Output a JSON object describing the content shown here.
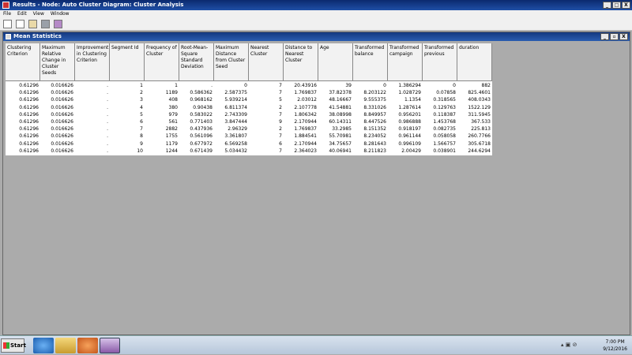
{
  "window": {
    "title": "Results - Node: Auto Cluster  Diagram: Cluster Analysis",
    "min": "_",
    "max": "□",
    "close": "X"
  },
  "menu": [
    "File",
    "Edit",
    "View",
    "Window"
  ],
  "subwindow": {
    "title": "Mean Statistics",
    "min": "_",
    "max": "▫",
    "close": "X"
  },
  "table": {
    "headers": [
      "Clustering Criterion",
      "Maximum Relative Change in Cluster Seeds",
      "Improvement in Clustering Criterion",
      "Segment Id",
      "Frequency of Cluster",
      "Root-Mean-Square Standard Deviation",
      "Maximum Distance from Cluster Seed",
      "Nearest Cluster",
      "Distance to Nearest Cluster",
      "Age",
      "Transformed balance",
      "Transformed campaign",
      "Transformed previous",
      "duration"
    ],
    "rows": [
      [
        "0.61296",
        "0.016626",
        ".",
        "1",
        "1",
        ".",
        "0",
        "7",
        "20.43916",
        "39",
        "0",
        "1.386294",
        "0",
        "882"
      ],
      [
        "0.61296",
        "0.016626",
        ".",
        "2",
        "1189",
        "0.586362",
        "2.587375",
        "7",
        "1.769837",
        "37.82378",
        "8.203122",
        "1.028729",
        "0.07858",
        "825.4601"
      ],
      [
        "0.61296",
        "0.016626",
        ".",
        "3",
        "408",
        "0.968162",
        "5.939214",
        "5",
        "2.03012",
        "48.16667",
        "9.555375",
        "1.1354",
        "0.318565",
        "408.0343"
      ],
      [
        "0.61296",
        "0.016626",
        ".",
        "4",
        "380",
        "0.90438",
        "6.811374",
        "2",
        "2.107778",
        "41.54881",
        "8.331026",
        "1.287614",
        "0.129763",
        "1522.129"
      ],
      [
        "0.61296",
        "0.016626",
        ".",
        "5",
        "979",
        "0.583022",
        "2.743309",
        "7",
        "1.806342",
        "38.08998",
        "8.849957",
        "0.956201",
        "0.118387",
        "311.5945"
      ],
      [
        "0.61296",
        "0.016626",
        ".",
        "6",
        "561",
        "0.771403",
        "3.847444",
        "9",
        "2.170944",
        "60.14311",
        "8.447526",
        "0.986888",
        "1.453768",
        "367.533"
      ],
      [
        "0.61296",
        "0.016626",
        ".",
        "7",
        "2882",
        "0.437936",
        "2.96329",
        "2",
        "1.769837",
        "33.2985",
        "8.151352",
        "0.918197",
        "0.082735",
        "225.813"
      ],
      [
        "0.61296",
        "0.016626",
        ".",
        "8",
        "1755",
        "0.561096",
        "3.361807",
        "7",
        "1.884541",
        "55.70981",
        "8.234052",
        "0.961144",
        "0.058058",
        "260.7766"
      ],
      [
        "0.61296",
        "0.016626",
        ".",
        "9",
        "1179",
        "0.677972",
        "6.569258",
        "6",
        "2.170944",
        "34.75657",
        "8.281643",
        "0.996109",
        "1.566757",
        "305.6718"
      ],
      [
        "0.61296",
        "0.016626",
        ".",
        "10",
        "1244",
        "0.671439",
        "5.034432",
        "7",
        "2.364023",
        "40.06941",
        "8.211823",
        "2.00429",
        "0.038901",
        "244.6294"
      ]
    ]
  },
  "taskbar": {
    "start": "Start",
    "time": "7:00 PM",
    "date": "9/12/2016"
  }
}
